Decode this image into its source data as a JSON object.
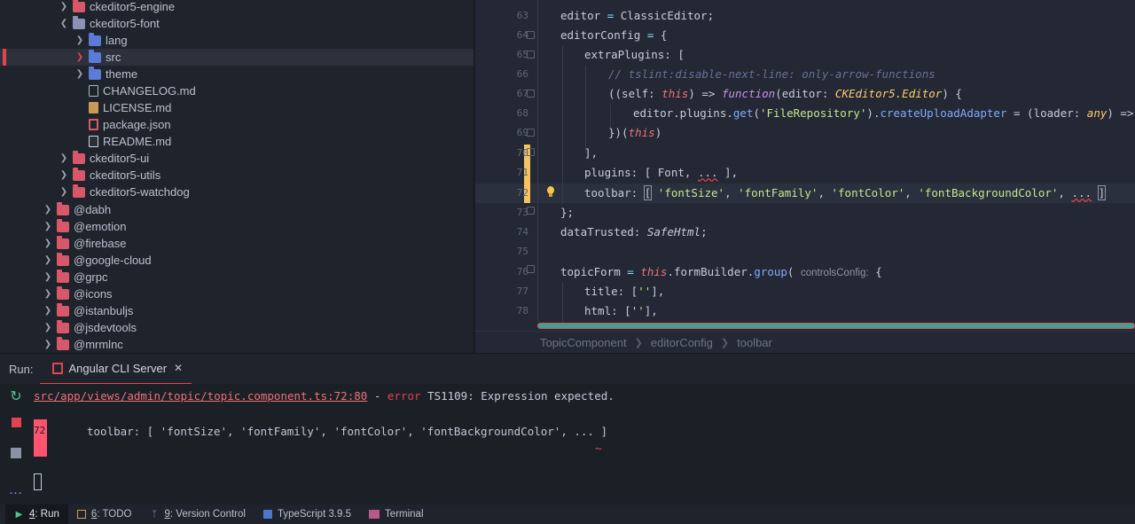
{
  "tree": {
    "items": [
      {
        "label": "ckeditor5-engine",
        "kind": "folder",
        "depth": 1,
        "expanded": false
      },
      {
        "label": "ckeditor5-font",
        "kind": "folder-grey",
        "depth": 1,
        "expanded": true
      },
      {
        "label": "lang",
        "kind": "folder-blue",
        "depth": 2,
        "expanded": false
      },
      {
        "label": "src",
        "kind": "folder-blue",
        "depth": 2,
        "expanded": false,
        "selected": true
      },
      {
        "label": "theme",
        "kind": "folder-blue",
        "depth": 2,
        "expanded": false
      },
      {
        "label": "CHANGELOG.md",
        "kind": "file-md",
        "depth": 2
      },
      {
        "label": "LICENSE.md",
        "kind": "file-lic",
        "depth": 2
      },
      {
        "label": "package.json",
        "kind": "file-json",
        "depth": 2
      },
      {
        "label": "README.md",
        "kind": "file-readme",
        "depth": 2
      },
      {
        "label": "ckeditor5-ui",
        "kind": "folder",
        "depth": 1,
        "expanded": false
      },
      {
        "label": "ckeditor5-utils",
        "kind": "folder",
        "depth": 1,
        "expanded": false
      },
      {
        "label": "ckeditor5-watchdog",
        "kind": "folder",
        "depth": 1,
        "expanded": false
      },
      {
        "label": "@dabh",
        "kind": "folder",
        "depth": 0,
        "expanded": false
      },
      {
        "label": "@emotion",
        "kind": "folder",
        "depth": 0,
        "expanded": false
      },
      {
        "label": "@firebase",
        "kind": "folder",
        "depth": 0,
        "expanded": false
      },
      {
        "label": "@google-cloud",
        "kind": "folder",
        "depth": 0,
        "expanded": false
      },
      {
        "label": "@grpc",
        "kind": "folder",
        "depth": 0,
        "expanded": false
      },
      {
        "label": "@icons",
        "kind": "folder",
        "depth": 0,
        "expanded": false
      },
      {
        "label": "@istanbuljs",
        "kind": "folder",
        "depth": 0,
        "expanded": false
      },
      {
        "label": "@jsdevtools",
        "kind": "folder",
        "depth": 0,
        "expanded": false
      },
      {
        "label": "@mrmlnc",
        "kind": "folder",
        "depth": 0,
        "expanded": false
      }
    ]
  },
  "editor": {
    "line_numbers": [
      "63",
      "64",
      "65",
      "66",
      "67",
      "68",
      "69",
      "70",
      "71",
      "72",
      "73",
      "74",
      "75",
      "76",
      "77",
      "78"
    ],
    "lines": {
      "l63": {
        "a": "editor ",
        "b": "=",
        "c": " ClassicEditor;"
      },
      "l64": {
        "a": "editorConfig ",
        "b": "=",
        "c": " {"
      },
      "l65": {
        "a": "extraPlugins: ["
      },
      "l66": {
        "a": "// tslint:disable-next-line: only-arrow-functions"
      },
      "l67": {
        "a": "((self: ",
        "b": "this",
        "c": ") => ",
        "d": "function",
        "e": "(editor: ",
        "f": "CKEditor5.Editor",
        "g": ") {"
      },
      "l68": {
        "a": "editor.plugins.",
        "b": "get",
        "c": "(",
        "d": "'FileRepository'",
        "e": ").",
        "f": "createUploadAdapter",
        "g": " = (loader: ",
        "h": "any",
        "i": ") => self.ed"
      },
      "l69": {
        "a": "})(",
        "b": "this",
        "c": ")"
      },
      "l70": {
        "a": "],"
      },
      "l71": {
        "a": "plugins: [ Font, ",
        "b": "...",
        "c": " ],"
      },
      "l72": {
        "a": "toolbar: ",
        "b": "[",
        "c": " ",
        "d": "'fontSize'",
        "e": ", ",
        "f": "'fontFamily'",
        "g": ", ",
        "h": "'fontColor'",
        "i": ", ",
        "j": "'fontBackgroundColor'",
        "k": ", ",
        "l": "...",
        "m": " ",
        "n": "]"
      },
      "l73": {
        "a": "};"
      },
      "l74": {
        "a": "dataTrusted: ",
        "b": "SafeHtml",
        "c": ";"
      },
      "l76": {
        "a": "topicForm ",
        "b": "=",
        "c": " ",
        "d": "this",
        "e": ".formBuilder.",
        "f": "group",
        "g": "( ",
        "h": "controlsConfig:",
        "i": " {"
      },
      "l77": {
        "a": "title: [",
        "b": "''",
        "c": "],"
      },
      "l78": {
        "a": "html: [",
        "b": "''",
        "c": "],"
      }
    }
  },
  "breadcrumbs": [
    "TopicComponent",
    "editorConfig",
    "toolbar"
  ],
  "run_panel": {
    "label": "Run:",
    "tab": "Angular CLI Server",
    "console": {
      "path": "src/app/views/admin/topic/topic.component.ts:72:80",
      "sep": " - ",
      "error_word": "error",
      "error_code": " TS1109:",
      "message": " Expression expected.",
      "line_number": "72",
      "code": "toolbar: [ 'fontSize', 'fontFamily', 'fontColor', 'fontBackgroundColor', ... ]",
      "tilde": "~"
    }
  },
  "tool_windows": [
    {
      "num": "4",
      "label": ": Run",
      "icon": "play-icon",
      "active": true
    },
    {
      "num": "6",
      "label": ": TODO",
      "icon": "todo-icon",
      "active": false
    },
    {
      "num": "9",
      "label": ": Version Control",
      "icon": "branch-icon",
      "active": false
    },
    {
      "num": "",
      "label": "TypeScript 3.9.5",
      "icon": "typescript-icon",
      "active": false
    },
    {
      "num": "",
      "label": "Terminal",
      "icon": "terminal-icon",
      "active": false
    }
  ],
  "colors": {
    "accent": "#e0454f",
    "change": "#f5c261",
    "keyword": "#c792ea",
    "string": "#c3e88d"
  }
}
